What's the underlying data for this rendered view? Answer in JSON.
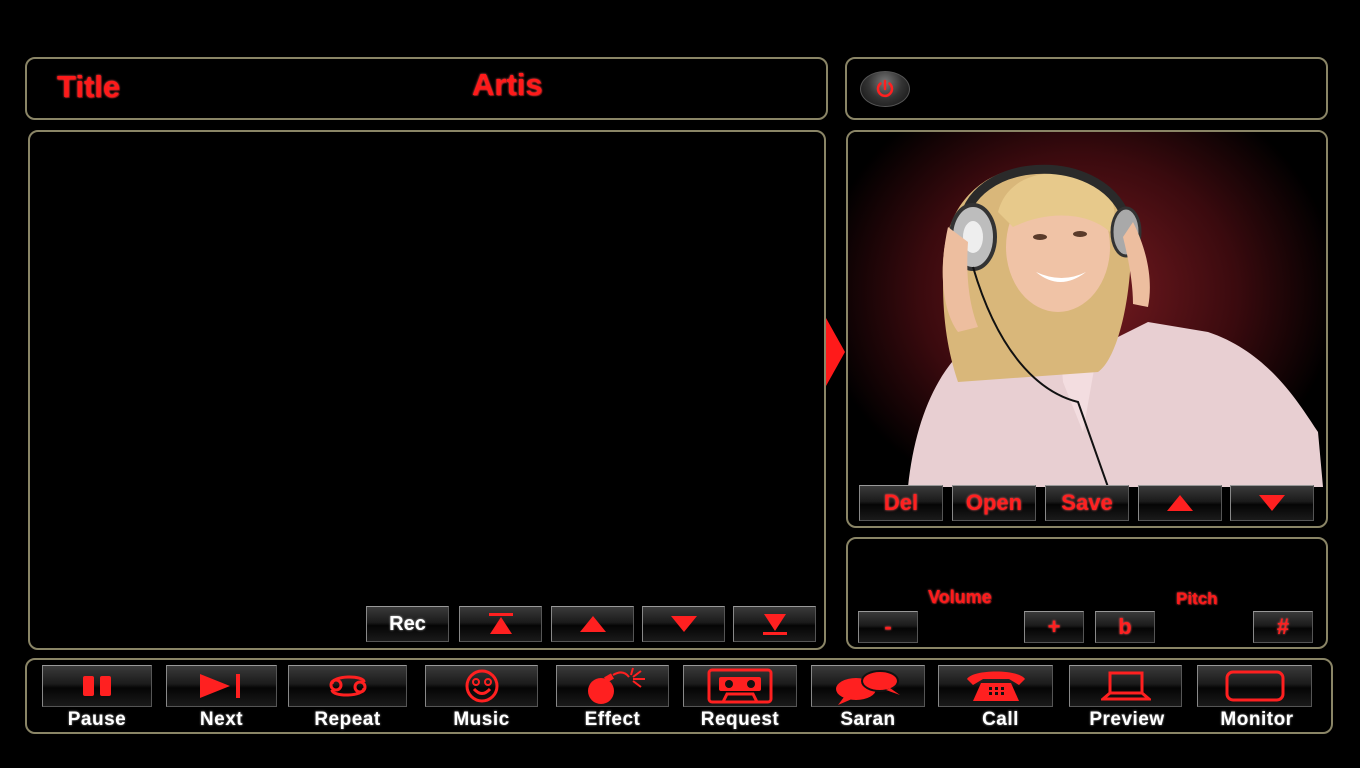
{
  "header": {
    "title_label": "Title",
    "artist_label": "Artis"
  },
  "power": {
    "icon": "power-icon"
  },
  "artist_photo": {
    "description": "woman-with-headphones"
  },
  "list_controls": {
    "rec_label": "Rec",
    "top_icon": "move-top-icon",
    "up_icon": "move-up-icon",
    "down_icon": "move-down-icon",
    "bottom_icon": "move-bottom-icon"
  },
  "playlist_controls": {
    "del_label": "Del",
    "open_label": "Open",
    "save_label": "Save",
    "up_icon": "triangle-up-icon",
    "down_icon": "triangle-down-icon"
  },
  "audio": {
    "volume_label": "Volume",
    "pitch_label": "Pitch",
    "minus_label": "-",
    "plus_label": "+",
    "flat_label": "b",
    "sharp_label": "#"
  },
  "bottom_bar": [
    {
      "label": "Pause",
      "icon": "pause-icon"
    },
    {
      "label": "Next",
      "icon": "next-icon"
    },
    {
      "label": "Repeat",
      "icon": "repeat-icon"
    },
    {
      "label": "Music",
      "icon": "smiley-icon"
    },
    {
      "label": "Effect",
      "icon": "bomb-icon"
    },
    {
      "label": "Request",
      "icon": "cassette-icon"
    },
    {
      "label": "Saran",
      "icon": "chat-bubbles-icon"
    },
    {
      "label": "Call",
      "icon": "telephone-icon"
    },
    {
      "label": "Preview",
      "icon": "laptop-icon"
    },
    {
      "label": "Monitor",
      "icon": "monitor-icon"
    }
  ],
  "colors": {
    "accent": "#ff1a1a",
    "border": "#8a8566",
    "background": "#000000"
  }
}
